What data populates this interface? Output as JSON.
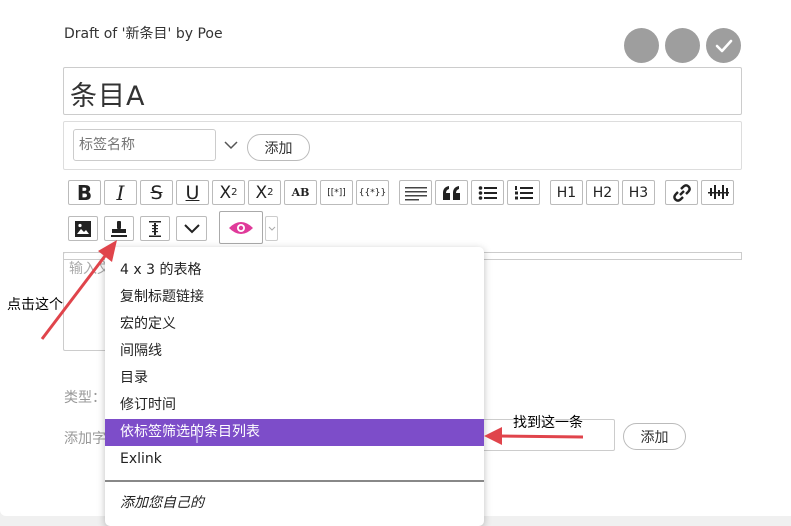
{
  "header": {
    "draft_text": "Draft of '新条目' by Poe"
  },
  "title": {
    "value": "条目A"
  },
  "tags": {
    "placeholder": "标签名称",
    "add_label": "添加"
  },
  "toolbar": {
    "bold": "B",
    "italic": "I",
    "strike": "S",
    "underline": "U",
    "superscript": "X",
    "sup_mark": "2",
    "subscript": "X",
    "sub_mark": "2",
    "smallcaps": "AB",
    "link_brackets": "[[*]]",
    "transclude": "{{*}}",
    "h1": "H1",
    "h2": "H2",
    "h3": "H3"
  },
  "editor": {
    "placeholder": "输入文"
  },
  "fields": {
    "type_label": "类型：",
    "add_field_label": "添加字段",
    "add_label": "添加"
  },
  "menu": {
    "items": [
      "4 x 3 的表格",
      "复制标题链接",
      "宏的定义",
      "间隔线",
      "目录",
      "修订时间",
      "依标签筛选的条目列表",
      "Exlink"
    ],
    "custom": "添加您自己的"
  },
  "annotations": {
    "left": "点击这个",
    "right": "找到这一条"
  },
  "colors": {
    "accent": "#7d4dc9",
    "arrow": "#e0444b",
    "eye": "#e03a9a"
  }
}
